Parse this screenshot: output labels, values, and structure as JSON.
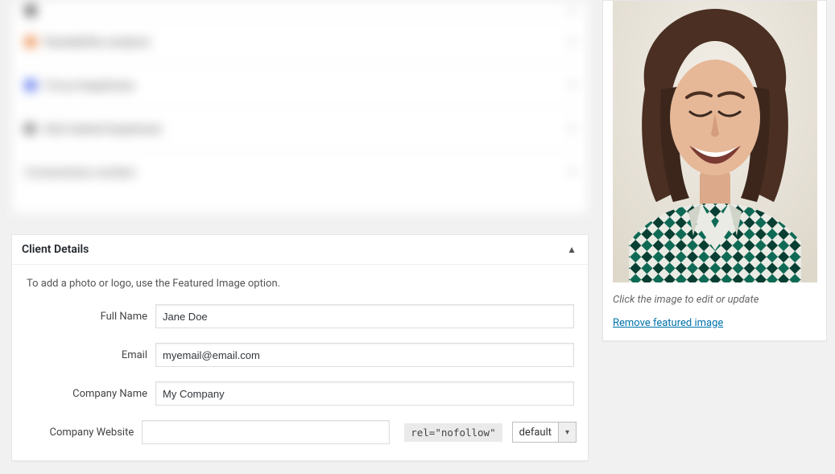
{
  "blurred_section": {
    "rows": [
      {
        "bullet_color": "#444444",
        "label": ""
      },
      {
        "bullet_color": "#e8762d",
        "label": "Readability analysis"
      },
      {
        "bullet_color": "#3858e9",
        "label": "Focus keyphrase"
      },
      {
        "bullet_color": "#666666",
        "label": "Add related keyphrase"
      },
      {
        "bullet_color": "#ffffff",
        "label": "Cornerstone content"
      }
    ]
  },
  "client_details": {
    "title": "Client Details",
    "description": "To add a photo or logo, use the Featured Image option.",
    "fields": {
      "full_name": {
        "label": "Full Name",
        "value": "Jane Doe"
      },
      "email": {
        "label": "Email",
        "value": "myemail@email.com"
      },
      "company_name": {
        "label": "Company Name",
        "value": "My Company"
      },
      "company_website": {
        "label": "Company Website",
        "value": "",
        "rel_attr_text": "rel=\"nofollow\"",
        "rel_select_value": "default"
      }
    }
  },
  "featured_image": {
    "caption": "Click the image to edit or update",
    "remove_label": "Remove featured image"
  }
}
